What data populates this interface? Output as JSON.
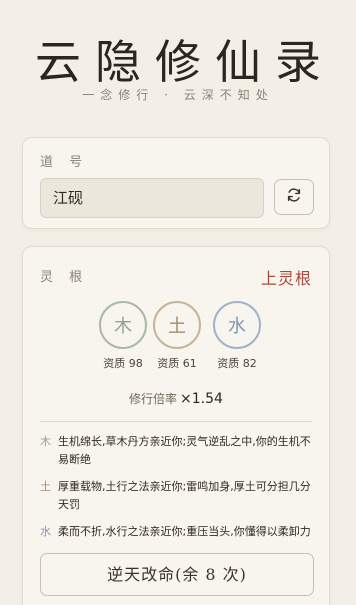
{
  "header": {
    "title": "云隐修仙录",
    "subtitle": "一念修行 · 云深不知处"
  },
  "name_card": {
    "label": "道 号",
    "name_value": "江砚",
    "refresh_icon": "refresh-icon"
  },
  "root_card": {
    "label": "灵 根",
    "grade": "上灵根",
    "roots": [
      {
        "element": "木",
        "quality_label": "资质 98",
        "quality": 98,
        "color": "#a9b9a8",
        "text_color": "#8fa58e"
      },
      {
        "element": "土",
        "quality_label": "资质 61",
        "quality": 61,
        "color": "#c7b29a",
        "text_color": "#a48a6c"
      },
      {
        "element": "水",
        "quality_label": "资质 82",
        "quality": 82,
        "color": "#9fb4cc",
        "text_color": "#7d97b4"
      }
    ],
    "rate_label": "修行倍率",
    "rate_value": "×1.54",
    "traits": [
      {
        "element": "木",
        "color": "#8fa58e",
        "text": "生机绵长,草木丹方亲近你;灵气逆乱之中,你的生机不易断绝"
      },
      {
        "element": "土",
        "color": "#a48a6c",
        "text": "厚重载物,土行之法亲近你;雷鸣加身,厚土可分担几分天罚"
      },
      {
        "element": "水",
        "color": "#7d97b4",
        "text": "柔而不折,水行之法亲近你;重压当头,你懂得以柔卸力"
      }
    ],
    "fate_button": "逆天改命(余 8 次)"
  },
  "colors": {
    "background": "#f3efe6",
    "card": "#f8f5ee",
    "accent_red": "#a8493c"
  }
}
